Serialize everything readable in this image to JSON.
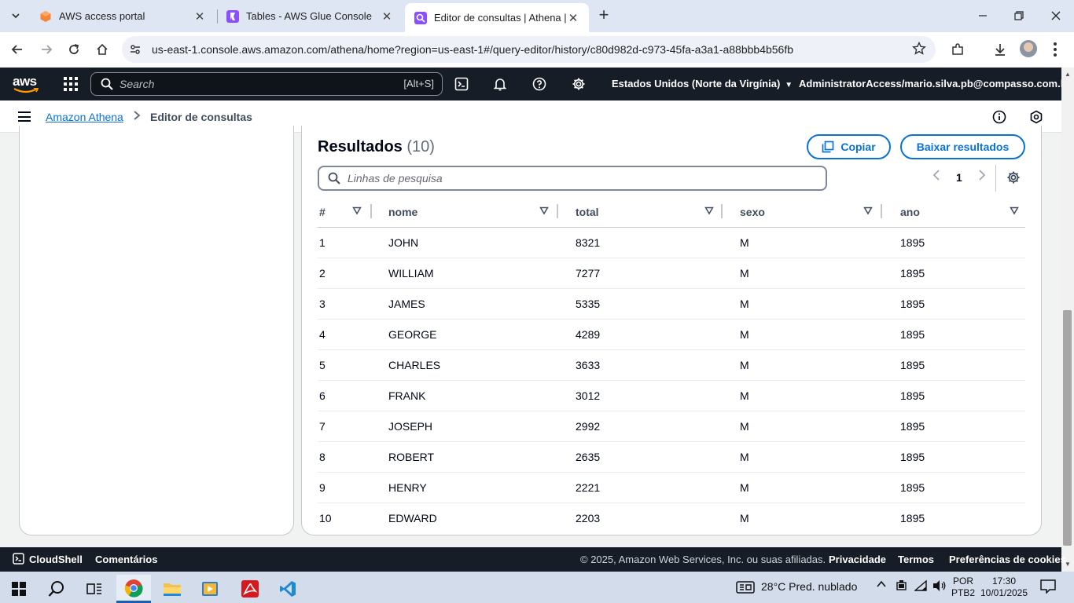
{
  "browser": {
    "tabs": [
      {
        "title": "AWS access portal"
      },
      {
        "title": "Tables - AWS Glue Console"
      },
      {
        "title": "Editor de consultas | Athena | us"
      }
    ],
    "url": "us-east-1.console.aws.amazon.com/athena/home?region=us-east-1#/query-editor/history/c80d982d-c973-45fa-a3a1-a88bbb4b56fb"
  },
  "aws_nav": {
    "logo": "aws",
    "search_placeholder": "Search",
    "search_shortcut": "[Alt+S]",
    "region": "Estados Unidos (Norte da Virgínia)",
    "account": "AdministratorAccess/mario.silva.pb@compasso.com.br"
  },
  "breadcrumb": {
    "service": "Amazon Athena",
    "current": "Editor de consultas"
  },
  "results": {
    "title": "Resultados",
    "count": "(10)",
    "copy_label": "Copiar",
    "download_label": "Baixar resultados",
    "filter_placeholder": "Linhas de pesquisa",
    "page": "1",
    "columns": [
      "#",
      "nome",
      "total",
      "sexo",
      "ano"
    ],
    "rows": [
      [
        "1",
        "JOHN",
        "8321",
        "M",
        "1895"
      ],
      [
        "2",
        "WILLIAM",
        "7277",
        "M",
        "1895"
      ],
      [
        "3",
        "JAMES",
        "5335",
        "M",
        "1895"
      ],
      [
        "4",
        "GEORGE",
        "4289",
        "M",
        "1895"
      ],
      [
        "5",
        "CHARLES",
        "3633",
        "M",
        "1895"
      ],
      [
        "6",
        "FRANK",
        "3012",
        "M",
        "1895"
      ],
      [
        "7",
        "JOSEPH",
        "2992",
        "M",
        "1895"
      ],
      [
        "8",
        "ROBERT",
        "2635",
        "M",
        "1895"
      ],
      [
        "9",
        "HENRY",
        "2221",
        "M",
        "1895"
      ],
      [
        "10",
        "EDWARD",
        "2203",
        "M",
        "1895"
      ]
    ]
  },
  "footer": {
    "cloudshell": "CloudShell",
    "feedback": "Comentários",
    "copyright": "© 2025, Amazon Web Services, Inc. ou suas afiliadas.",
    "privacy": "Privacidade",
    "terms": "Termos",
    "cookies": "Preferências de cookies"
  },
  "taskbar": {
    "weather": "28°C  Pred. nublado",
    "lang_1": "POR",
    "lang_2": "PTB2",
    "time": "17:30",
    "date": "10/01/2025"
  },
  "colors": {
    "aws_nav_bg": "#161d26",
    "link_blue": "#0972d3",
    "aws_orange": "#ff9900"
  }
}
